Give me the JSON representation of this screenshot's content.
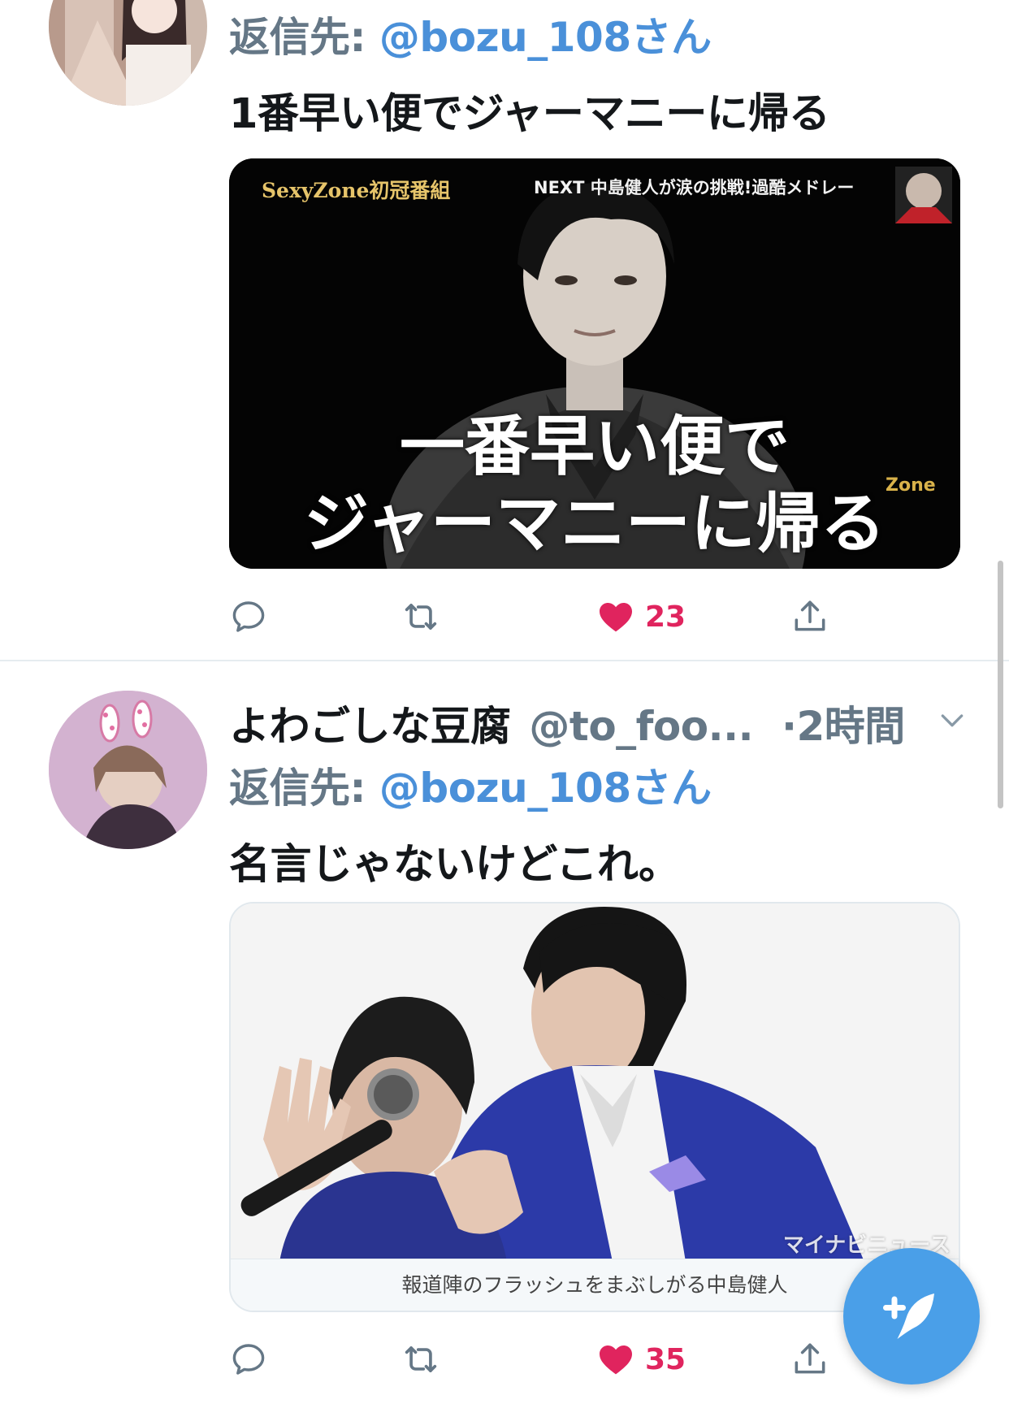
{
  "tweets": [
    {
      "reply_prefix": "返信先: ",
      "reply_handle": "@bozu_108さん",
      "text": "1番早い便でジャーマニーに帰る",
      "image": {
        "top_left_logo": "SexyZone初冠番組",
        "top_right_banner": "NEXT 中島健人が涙の挑戦!過酷メドレー",
        "caption_line1": "一番早い便で",
        "caption_line2": "ジャーマニーに帰る",
        "side_text": "Zone"
      },
      "actions": {
        "reply_icon": "reply-icon",
        "retweet_icon": "retweet-icon",
        "like_icon": "heart-filled-icon",
        "like_count": "23",
        "share_icon": "share-icon"
      }
    },
    {
      "display_name": "よわごしな豆腐",
      "username": "@to_foo...",
      "time": "·2時間",
      "reply_prefix": "返信先: ",
      "reply_handle": "@bozu_108さん",
      "text": "名言じゃないけどこれ。",
      "image": {
        "watermark": "マイナビニュース",
        "caption": "報道陣のフラッシュをまぶしがる中島健人"
      },
      "actions": {
        "reply_icon": "reply-icon",
        "retweet_icon": "retweet-icon",
        "like_icon": "heart-filled-icon",
        "like_count": "35",
        "share_icon": "share-icon"
      }
    }
  ],
  "colors": {
    "like": "#e0245e",
    "link": "#4a90d9",
    "secondary": "#657786",
    "fab": "#4a9fe8"
  },
  "compose_button_icon": "compose-tweet-icon"
}
